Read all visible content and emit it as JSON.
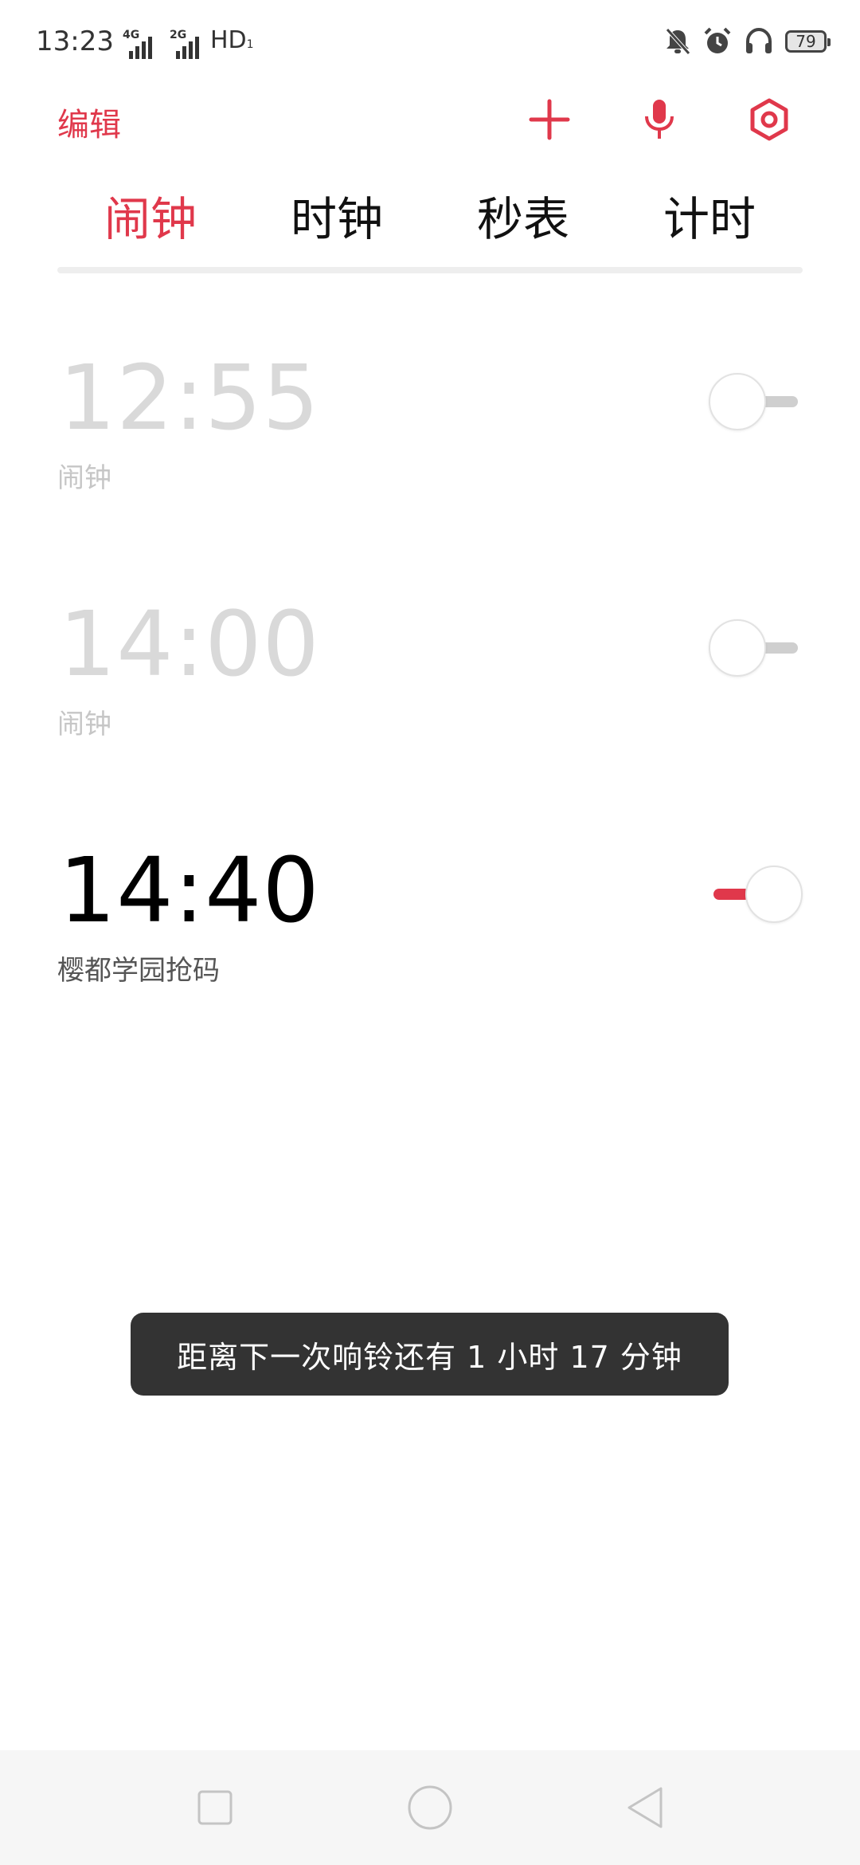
{
  "status_bar": {
    "time": "13:23",
    "network_1": "4G",
    "network_2": "2G",
    "hd": "HD",
    "hd_sub": "1",
    "battery": "79"
  },
  "toolbar": {
    "edit_label": "编辑",
    "icons": [
      "add-icon",
      "microphone-icon",
      "settings-icon"
    ]
  },
  "tabs": [
    {
      "label": "闹钟",
      "active": true
    },
    {
      "label": "时钟",
      "active": false
    },
    {
      "label": "秒表",
      "active": false
    },
    {
      "label": "计时",
      "active": false
    }
  ],
  "alarms": [
    {
      "time": "12:55",
      "label": "闹钟",
      "enabled": false
    },
    {
      "time": "14:00",
      "label": "闹钟",
      "enabled": false
    },
    {
      "time": "14:40",
      "label": "樱都学园抢码",
      "enabled": true
    }
  ],
  "toast": {
    "message": "距离下一次响铃还有 1 小时 17 分钟"
  },
  "colors": {
    "accent": "#e0384b",
    "disabled_text": "#d9d9d9",
    "toast_bg": "#333333"
  },
  "nav_bar": {
    "icons": [
      "recent-apps-icon",
      "home-icon",
      "back-icon"
    ]
  }
}
